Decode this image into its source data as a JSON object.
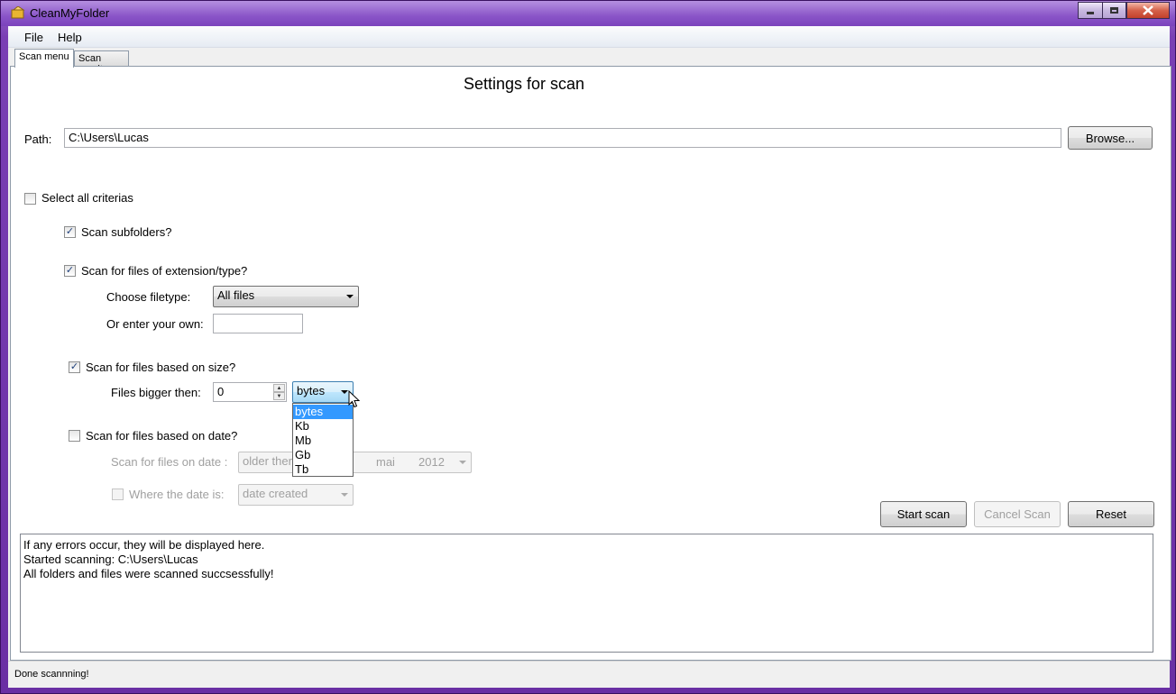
{
  "window": {
    "title": "CleanMyFolder"
  },
  "menu": {
    "items": [
      {
        "label": "File"
      },
      {
        "label": "Help"
      }
    ]
  },
  "tabs": [
    {
      "label": "Scan menu"
    },
    {
      "label": "Scan result"
    }
  ],
  "settings": {
    "title": "Settings for scan",
    "path": {
      "label": "Path:",
      "value": "C:\\Users\\Lucas"
    },
    "browse_label": "Browse...",
    "select_all": {
      "label": "Select all criterias",
      "checked": false
    },
    "subfolders": {
      "label": "Scan subfolders?",
      "checked": true
    },
    "extension": {
      "label": "Scan for files of extension/type?",
      "checked": true,
      "filetype_label": "Choose filetype:",
      "filetype_value": "All files",
      "own_label": "Or enter your own:",
      "own_value": ""
    },
    "size": {
      "label": "Scan for files based on size?",
      "checked": true,
      "bigger_label": "Files bigger then:",
      "bigger_value": "0",
      "unit_value": "bytes",
      "unit_options": [
        "bytes",
        "Kb",
        "Mb",
        "Gb",
        "Tb"
      ]
    },
    "date": {
      "label": "Scan for files based on date?",
      "checked": false,
      "on_date_label": "Scan for files on date :",
      "relation_value": "older ther",
      "month_value": "mai",
      "year_value": "2012",
      "where_label": "Where the date is:",
      "where_checked": false,
      "where_value": "date created"
    },
    "buttons": {
      "start": "Start scan",
      "cancel": "Cancel Scan",
      "reset": "Reset"
    }
  },
  "log": {
    "lines": [
      "If any errors occur, they will be displayed here.",
      "Started scanning: C:\\Users\\Lucas",
      "All folders and files were scanned succsessfully!"
    ]
  },
  "status": {
    "text": "Done scannning!"
  },
  "colors": {
    "titlebar": "#8a55c8",
    "selection": "#3399ff",
    "close": "#c2402a"
  }
}
